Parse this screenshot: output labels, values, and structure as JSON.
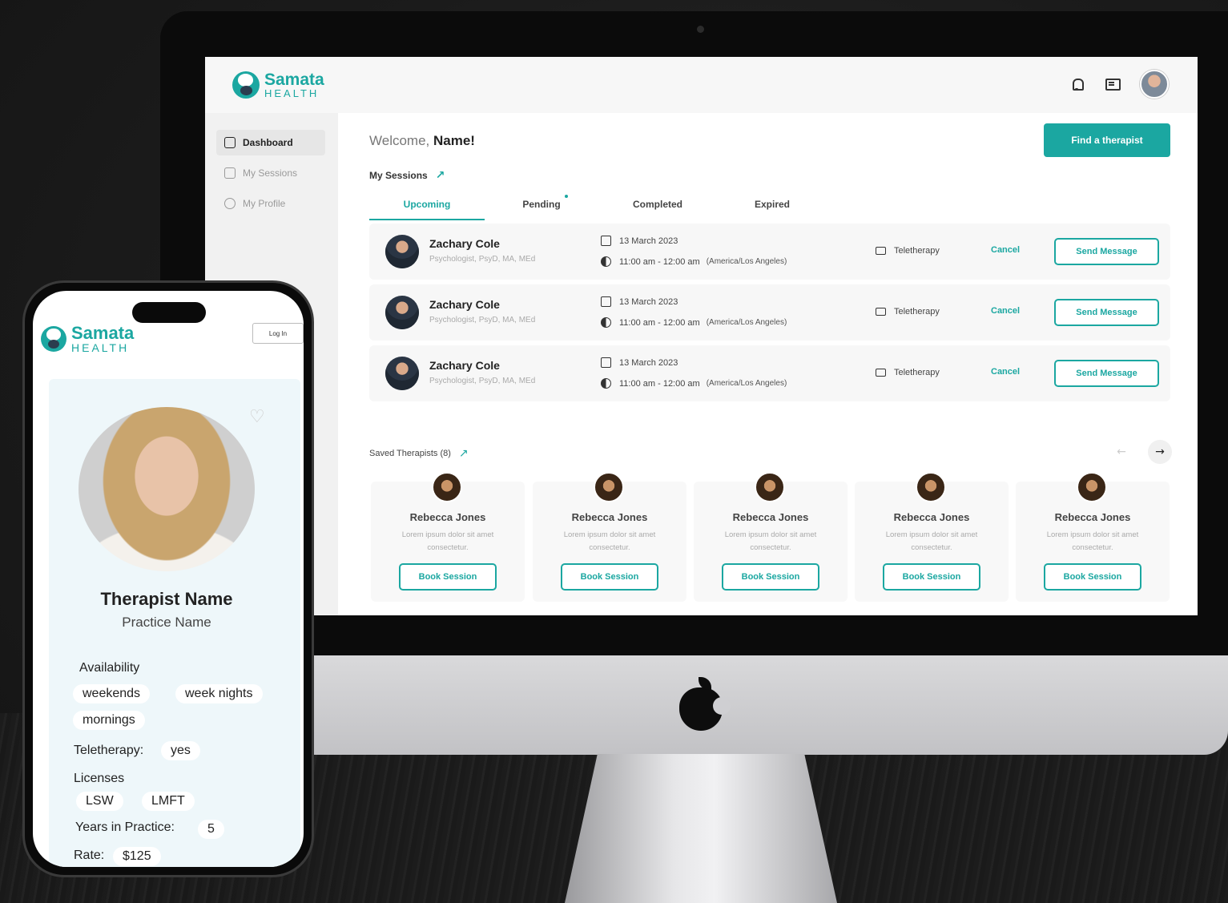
{
  "desktop": {
    "logo": {
      "name": "Samata",
      "sub": "HEALTH"
    },
    "sidebar": {
      "items": [
        {
          "label": "Dashboard"
        },
        {
          "label": "My Sessions"
        },
        {
          "label": "My Profile"
        }
      ]
    },
    "welcome": {
      "prefix": "Welcome,",
      "name": "Name!"
    },
    "find_button": "Find a therapist",
    "sessions": {
      "label": "My Sessions",
      "tabs": [
        {
          "label": "Upcoming"
        },
        {
          "label": "Pending"
        },
        {
          "label": "Completed"
        },
        {
          "label": "Expired"
        }
      ],
      "rows": [
        {
          "name": "Zachary Cole",
          "title": "Psychologist, PsyD, MA, MEd",
          "date": "13 March 2023",
          "time": "11:00 am - 12:00 am",
          "tz": "(America/Los Angeles)",
          "mode": "Teletherapy",
          "cancel": "Cancel",
          "message": "Send Message"
        },
        {
          "name": "Zachary Cole",
          "title": "Psychologist, PsyD, MA, MEd",
          "date": "13 March 2023",
          "time": "11:00 am - 12:00 am",
          "tz": "(America/Los Angeles)",
          "mode": "Teletherapy",
          "cancel": "Cancel",
          "message": "Send Message"
        },
        {
          "name": "Zachary Cole",
          "title": "Psychologist, PsyD, MA, MEd",
          "date": "13 March 2023",
          "time": "11:00 am - 12:00 am",
          "tz": "(America/Los Angeles)",
          "mode": "Teletherapy",
          "cancel": "Cancel",
          "message": "Send Message"
        }
      ]
    },
    "saved": {
      "label": "Saved Therapists (8)",
      "prev": "←",
      "next": "→",
      "cards": [
        {
          "name": "Rebecca Jones",
          "desc": "Lorem ipsum dolor sit amet consectetur.",
          "button": "Book Session"
        },
        {
          "name": "Rebecca Jones",
          "desc": "Lorem ipsum dolor sit amet consectetur.",
          "button": "Book Session"
        },
        {
          "name": "Rebecca Jones",
          "desc": "Lorem ipsum dolor sit amet consectetur.",
          "button": "Book Session"
        },
        {
          "name": "Rebecca Jones",
          "desc": "Lorem ipsum dolor sit amet consectetur.",
          "button": "Book Session"
        },
        {
          "name": "Rebecca Jones",
          "desc": "Lorem ipsum dolor sit amet consectetur.",
          "button": "Book Session"
        }
      ]
    },
    "accent_color": "#1ba7a1"
  },
  "mobile": {
    "logo": {
      "name": "Samata",
      "sub": "HEALTH"
    },
    "login": "Log In",
    "heart": "♡",
    "therapist_name": "Therapist Name",
    "practice_name": "Practice Name",
    "availability_label": "Availability",
    "availability": [
      "weekends",
      "week nights",
      "mornings"
    ],
    "teletherapy_label": "Teletherapy:",
    "teletherapy_value": "yes",
    "licenses_label": "Licenses",
    "licenses": [
      "LSW",
      "LMFT"
    ],
    "years_label": "Years in Practice:",
    "years_value": "5",
    "rate_label": "Rate:",
    "rate_value": "$125"
  }
}
